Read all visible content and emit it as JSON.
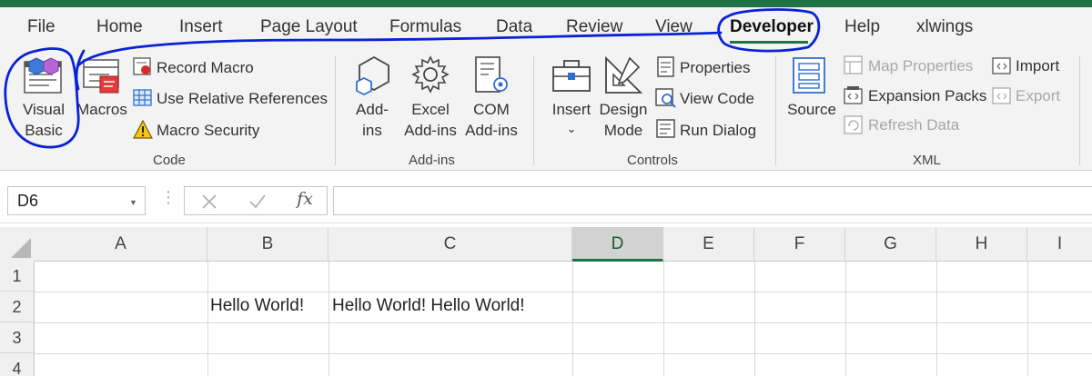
{
  "tabs": [
    "File",
    "Home",
    "Insert",
    "Page Layout",
    "Formulas",
    "Data",
    "Review",
    "View",
    "Developer",
    "Help",
    "xlwings"
  ],
  "active_tab": "Developer",
  "ribbon": {
    "code": {
      "label": "Code",
      "visual_basic": [
        "Visual",
        "Basic"
      ],
      "macros": "Macros",
      "record_macro": "Record Macro",
      "use_relative_refs": "Use Relative References",
      "macro_security": "Macro Security"
    },
    "addins": {
      "label": "Add-ins",
      "addins_btn": [
        "Add-",
        "ins"
      ],
      "excel_addins": [
        "Excel",
        "Add-ins"
      ],
      "com_addins": [
        "COM",
        "Add-ins"
      ]
    },
    "controls": {
      "label": "Controls",
      "insert": "Insert",
      "design_mode": [
        "Design",
        "Mode"
      ],
      "properties": "Properties",
      "view_code": "View Code",
      "run_dialog": "Run Dialog"
    },
    "xml": {
      "label": "XML",
      "source": "Source",
      "map_properties": "Map Properties",
      "expansion_packs": "Expansion Packs",
      "refresh_data": "Refresh Data",
      "import": "Import",
      "export": "Export"
    }
  },
  "formula_bar": {
    "name_box": "D6",
    "fx": "fx",
    "formula": ""
  },
  "columns": [
    "A",
    "B",
    "C",
    "D",
    "E",
    "F",
    "G",
    "H",
    "I"
  ],
  "selected_column": "D",
  "rows": [
    "1",
    "2",
    "3",
    "4"
  ],
  "cells": {
    "B2": "Hello World!",
    "C2": "Hello World! Hello World!"
  },
  "colors": {
    "accent_green": "#217346",
    "annotation_blue": "#0a22d6",
    "ribbon_bg": "#f3f3f3"
  }
}
